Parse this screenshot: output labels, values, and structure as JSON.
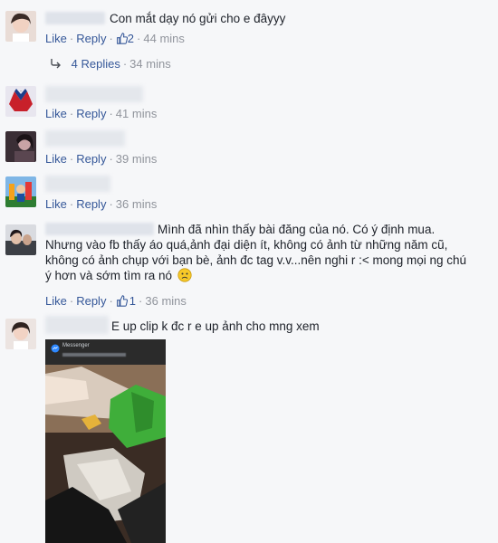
{
  "comments": [
    {
      "text": "Con mắt dạy nó gửi cho e đâyyy",
      "like_label": "Like",
      "reply_label": "Reply",
      "like_count": "2",
      "time": "44 mins",
      "replies_label": "4 Replies",
      "replies_time": "34 mins"
    },
    {
      "like_label": "Like",
      "reply_label": "Reply",
      "time": "41 mins"
    },
    {
      "like_label": "Like",
      "reply_label": "Reply",
      "time": "39 mins"
    },
    {
      "like_label": "Like",
      "reply_label": "Reply",
      "time": "36 mins"
    },
    {
      "text_lines": [
        "Mình đã nhìn thấy bài đăng của nó. Có ý định mua.",
        "Nhưng vào fb thấy áo quá,ảnh đại diện ít, không có ảnh từ những năm cũ,",
        "không có ảnh chụp với bạn bè, ảnh đc tag v.v...nên nghi r :< mong mọi ng chú",
        "ý hơn và sớm tìm ra nó"
      ],
      "like_label": "Like",
      "reply_label": "Reply",
      "like_count": "1",
      "time": "36 mins"
    },
    {
      "text": "E up clip k đc r e up ảnh cho mng xem"
    }
  ],
  "screenshot_header": "Messenger",
  "colors": {
    "link": "#365899",
    "meta": "#90949c",
    "background": "#f6f7f9"
  }
}
